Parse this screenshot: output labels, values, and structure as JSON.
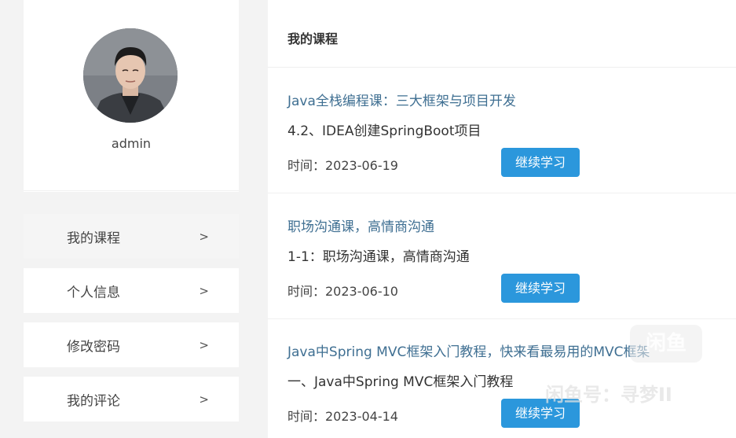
{
  "profile": {
    "username": "admin"
  },
  "sidebar": {
    "items": [
      {
        "label": "我的课程",
        "arrow": ">",
        "active": true
      },
      {
        "label": "个人信息",
        "arrow": ">",
        "active": false
      },
      {
        "label": "修改密码",
        "arrow": ">",
        "active": false
      },
      {
        "label": "我的评论",
        "arrow": ">",
        "active": false
      }
    ]
  },
  "main": {
    "title": "我的课程",
    "courses": [
      {
        "title": "Java全栈编程课：三大框架与项目开发",
        "lesson": "4.2、IDEA创建SpringBoot项目",
        "time": "时间：2023-06-19",
        "button": "继续学习"
      },
      {
        "title": "职场沟通课，高情商沟通",
        "lesson": "1-1：职场沟通课，高情商沟通",
        "time": "时间：2023-06-10",
        "button": "继续学习"
      },
      {
        "title": "Java中Spring MVC框架入门教程，快来看最易用的MVC框架",
        "lesson": "一、Java中Spring MVC框架入门教程",
        "time": "时间：2023-04-14",
        "button": "继续学习"
      }
    ]
  },
  "watermark": {
    "logo": "闲鱼",
    "text": "闲鱼号：寻梦II"
  },
  "colors": {
    "link": "#3f6f92",
    "button": "#2b97dc",
    "background": "#f3f3f3"
  }
}
